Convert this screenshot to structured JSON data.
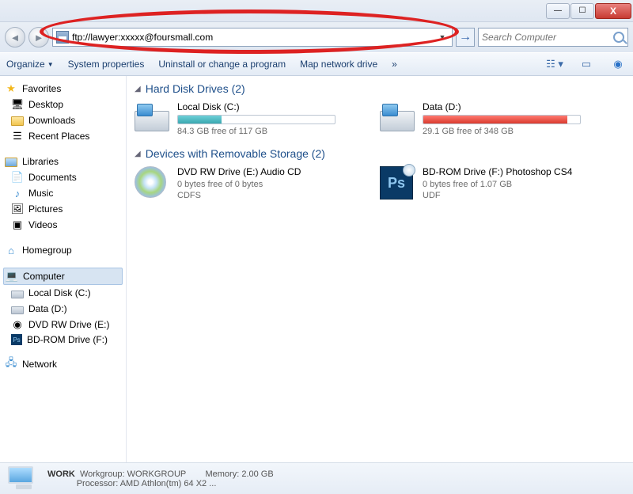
{
  "window": {
    "min": "—",
    "max": "☐",
    "close": "X"
  },
  "address": {
    "value": "ftp://lawyer:xxxxx@foursmall.com",
    "go_arrow": "→"
  },
  "search": {
    "placeholder": "Search Computer"
  },
  "toolbar": {
    "organize": "Organize",
    "sysprops": "System properties",
    "uninstall": "Uninstall or change a program",
    "mapdrive": "Map network drive",
    "more": "»"
  },
  "sidebar": {
    "favorites": "Favorites",
    "desktop": "Desktop",
    "downloads": "Downloads",
    "recent": "Recent Places",
    "libraries": "Libraries",
    "documents": "Documents",
    "music": "Music",
    "pictures": "Pictures",
    "videos": "Videos",
    "homegroup": "Homegroup",
    "computer": "Computer",
    "localc": "Local Disk (C:)",
    "datad": "Data (D:)",
    "dvde": "DVD RW Drive (E:)",
    "bdf": "BD-ROM Drive (F:)",
    "network": "Network"
  },
  "sections": {
    "hdd": "Hard Disk Drives (2)",
    "removable": "Devices with Removable Storage (2)"
  },
  "drives": {
    "c": {
      "name": "Local Disk (C:)",
      "free": "84.3 GB free of 117 GB",
      "pct": 28
    },
    "d": {
      "name": "Data (D:)",
      "free": "29.1 GB free of 348 GB",
      "pct": 92
    },
    "e": {
      "name": "DVD RW Drive (E:) Audio CD",
      "free": "0 bytes free of 0 bytes",
      "fs": "CDFS"
    },
    "f": {
      "name": "BD-ROM Drive (F:) Photoshop CS4",
      "free": "0 bytes free of 1.07 GB",
      "fs": "UDF"
    }
  },
  "details": {
    "name": "WORK",
    "wg_label": "Workgroup:",
    "wg": "WORKGROUP",
    "mem_label": "Memory:",
    "mem": "2.00 GB",
    "proc_label": "Processor:",
    "proc": "AMD Athlon(tm) 64 X2 ..."
  }
}
